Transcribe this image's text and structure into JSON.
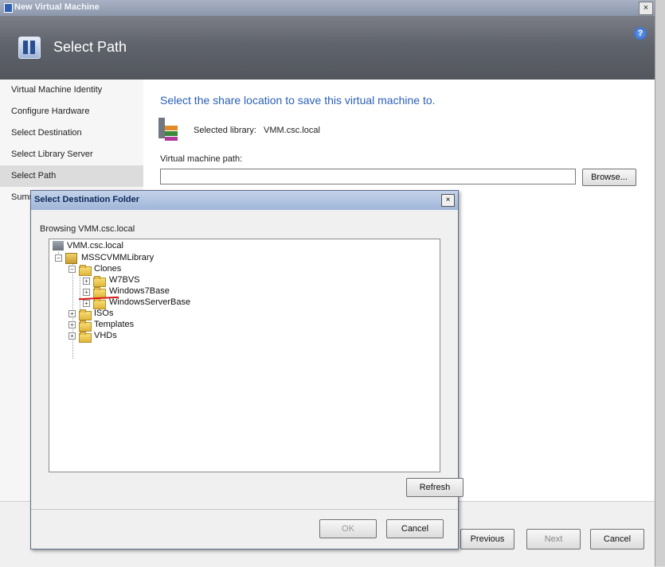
{
  "window": {
    "title": "New Virtual Machine",
    "close_label": "×"
  },
  "header": {
    "title": "Select Path",
    "help_label": "?"
  },
  "nav": {
    "items": [
      {
        "label": "Virtual Machine Identity"
      },
      {
        "label": "Configure Hardware"
      },
      {
        "label": "Select Destination"
      },
      {
        "label": "Select Library Server"
      },
      {
        "label": "Select Path"
      },
      {
        "label": "Summary"
      }
    ]
  },
  "main": {
    "heading": "Select the share location to save this virtual machine to.",
    "selected_library_label": "Selected library:",
    "selected_library_value": "VMM.csc.local",
    "vm_path_label": "Virtual machine path:",
    "vm_path_value": "",
    "browse_label": "Browse..."
  },
  "footer": {
    "previous_label": "Previous",
    "next_label": "Next",
    "cancel_label": "Cancel"
  },
  "dialog": {
    "title": "Select Destination Folder",
    "close_label": "×",
    "browsing_text": "Browsing VMM.csc.local",
    "tree": {
      "root": "VMM.csc.local",
      "library": "MSSCVMMLibrary",
      "clones": "Clones",
      "clone_children": [
        "W7BVS",
        "Windows7Base",
        "WindowsServerBase"
      ],
      "others": [
        "ISOs",
        "Templates",
        "VHDs"
      ]
    },
    "refresh_label": "Refresh",
    "ok_label": "OK",
    "cancel_label": "Cancel"
  }
}
